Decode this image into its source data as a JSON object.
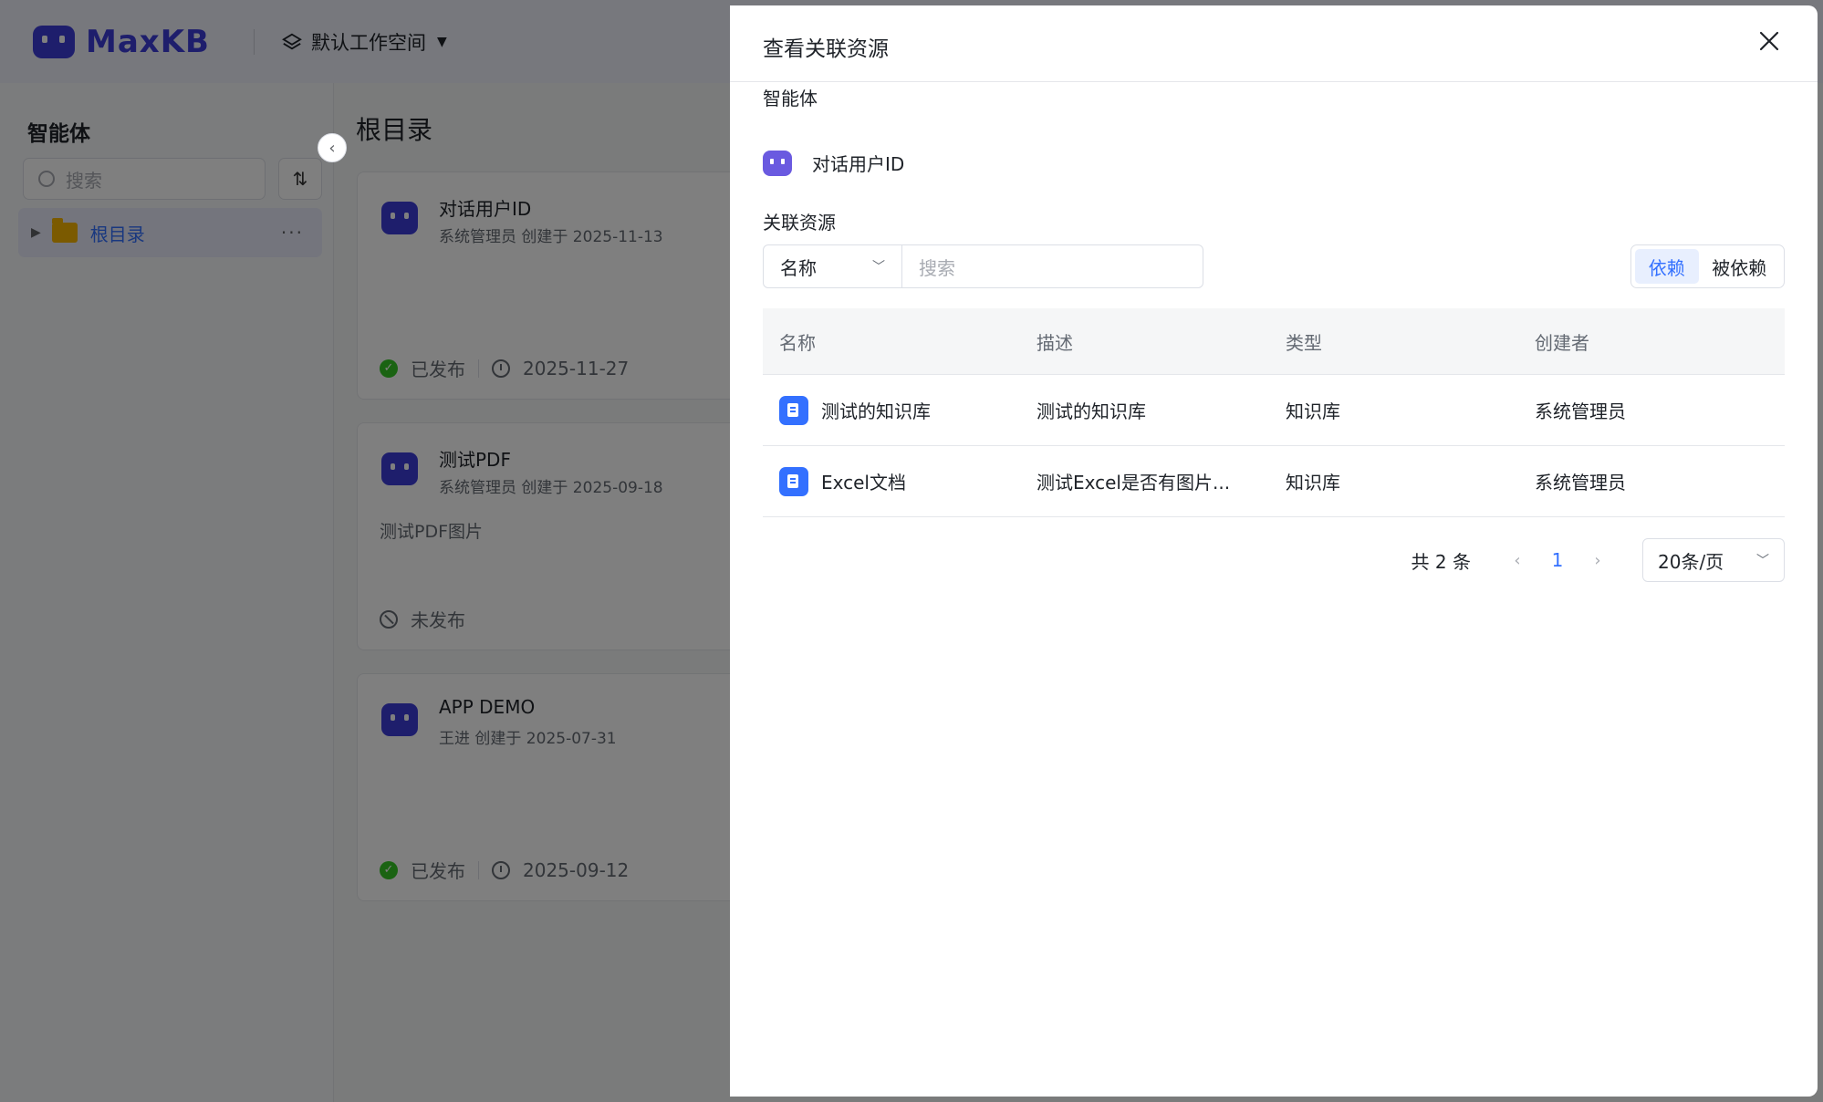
{
  "app": {
    "logo_text": "MaxKB",
    "workspace": "默认工作空间"
  },
  "sidebar": {
    "title": "智能体",
    "search_placeholder": "搜索",
    "tree": [
      {
        "label": "根目录"
      }
    ]
  },
  "main": {
    "title": "根目录",
    "cards": [
      {
        "name": "对话用户ID",
        "meta": "系统管理员 创建于 2025-11-13",
        "desc": "",
        "status": "已发布",
        "date": "2025-11-27"
      },
      {
        "name": "测试PDF",
        "meta": "系统管理员 创建于 2025-09-18",
        "desc": "测试PDF图片",
        "status": "未发布",
        "date": ""
      },
      {
        "name": "APP DEMO",
        "meta": "王进 创建于 2025-07-31",
        "desc": "",
        "status": "已发布",
        "date": "2025-09-12"
      }
    ]
  },
  "drawer": {
    "title": "查看关联资源",
    "agent_section_label": "智能体",
    "agent_name": "对话用户ID",
    "resources_section_label": "关联资源",
    "filter_field": "名称",
    "search_placeholder": "搜索",
    "segments": {
      "depends": "依赖",
      "depended_by": "被依赖",
      "active": "依赖"
    },
    "table": {
      "headers": [
        "名称",
        "描述",
        "类型",
        "创建者"
      ],
      "rows": [
        {
          "name": "测试的知识库",
          "desc": "测试的知识库",
          "type": "知识库",
          "creator": "系统管理员"
        },
        {
          "name": "Excel文档",
          "desc": "测试Excel是否有图片...",
          "type": "知识库",
          "creator": "系统管理员"
        }
      ]
    },
    "pagination": {
      "total": "共 2 条",
      "current_page": "1",
      "page_size": "20条/页"
    }
  },
  "colors": {
    "accent": "#3370ff",
    "brand": "#3d3dd8",
    "success": "#34c724",
    "folder": "#f6b400"
  }
}
